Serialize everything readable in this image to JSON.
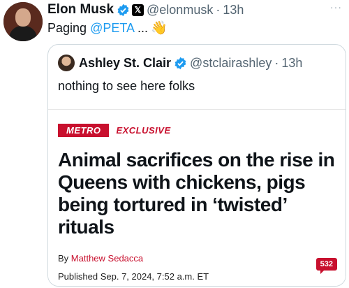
{
  "tweet": {
    "author_name": "Elon Musk",
    "author_handle": "@elonmusk",
    "separator": "·",
    "time": "13h",
    "text_prefix": "Paging",
    "mention": "@PETA",
    "text_suffix": "...",
    "emoji": "👋",
    "more_icon": "···"
  },
  "quoted": {
    "author_name": "Ashley St. Clair",
    "author_handle": "@stclairashley",
    "separator": "·",
    "time": "13h",
    "text": "nothing to see here folks"
  },
  "article": {
    "section": "METRO",
    "tag": "EXCLUSIVE",
    "headline": "Animal sacrifices on the rise in Queens with chickens, pigs being tortured in ‘twisted’ rituals",
    "by_label": "By",
    "author": "Matthew Sedacca",
    "published": "Published Sep. 7, 2024, 7:52 a.m. ET",
    "comments": "532"
  },
  "colors": {
    "verified": "#1d9bf0",
    "brand_red": "#c8102e",
    "muted": "#536471"
  }
}
